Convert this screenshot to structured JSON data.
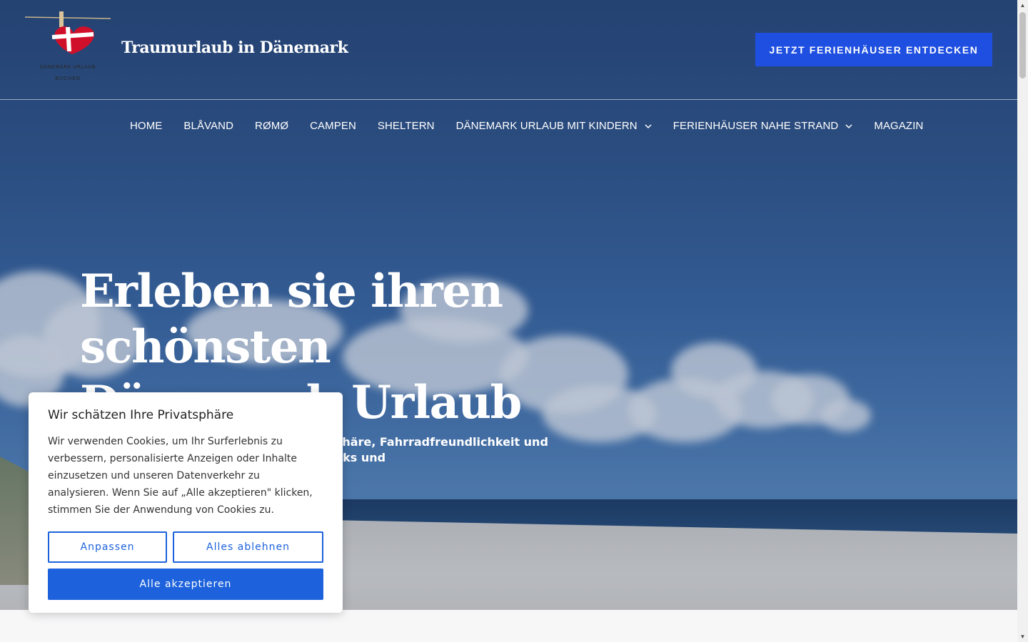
{
  "header": {
    "logo_text": "DÄNEMARK URLAUB BUCHEN",
    "site_title": "Traumurlaub in Dänemark",
    "cta_label": "JETZT FERIENHÄUSER ENTDECKEN"
  },
  "nav": {
    "items": [
      {
        "label": "HOME"
      },
      {
        "label": "BLÅVAND"
      },
      {
        "label": "RØMØ"
      },
      {
        "label": "CAMPEN"
      },
      {
        "label": "SHELTERN"
      },
      {
        "label": "DÄNEMARK URLAUB MIT KINDERN",
        "icon": "chevron-down-icon"
      },
      {
        "label": "FERIENHÄUSER NAHE STRAND",
        "icon": "chevron-down-icon"
      },
      {
        "label": "MAGAZIN"
      }
    ]
  },
  "hero": {
    "headline": "Erleben sie ihren schönsten Dänemark Urlaub",
    "subtext": "Entdecken Sie Dänemark: hygge Atmosphäre, Fahrradfreundlichkeit und Strände, kulinarische Genüsse, Naturparks und"
  },
  "cookie_banner": {
    "title": "Wir schätzen Ihre Privatsphäre",
    "text": "Wir verwenden Cookies, um Ihr Surferlebnis zu verbessern, personalisierte Anzeigen oder Inhalte einzusetzen und unseren Datenverkehr zu analysieren. Wenn Sie auf „Alle akzeptieren\" klicken, stimmen Sie der Anwendung von Cookies zu.",
    "customize_label": "Anpassen",
    "reject_label": "Alles ablehnen",
    "accept_label": "Alle akzeptieren"
  },
  "colors": {
    "cta": "#1e4fe0",
    "cookie_accent": "#1d62dc",
    "flag_red": "#d0102a"
  }
}
